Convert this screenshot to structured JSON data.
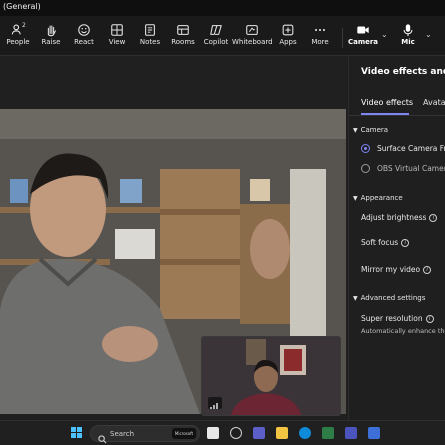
{
  "window": {
    "title": "(General)"
  },
  "toolbar": {
    "items": [
      {
        "label": "People",
        "count": "2",
        "icon": "people-icon"
      },
      {
        "label": "Raise",
        "icon": "hand-icon"
      },
      {
        "label": "React",
        "icon": "smile-icon"
      },
      {
        "label": "View",
        "icon": "view-grid-icon"
      },
      {
        "label": "Notes",
        "icon": "notes-icon"
      },
      {
        "label": "Rooms",
        "icon": "rooms-icon"
      },
      {
        "label": "Copilot",
        "icon": "copilot-icon"
      },
      {
        "label": "Whiteboard",
        "icon": "whiteboard-icon"
      },
      {
        "label": "Apps",
        "icon": "apps-add-icon"
      },
      {
        "label": "More",
        "icon": "more-icon"
      },
      {
        "label": "Camera",
        "icon": "camera-icon"
      },
      {
        "label": "Mic",
        "icon": "mic-icon"
      }
    ]
  },
  "panel": {
    "title": "Video effects and se",
    "tabs": [
      "Video effects",
      "Avata"
    ],
    "camera": {
      "heading": "Camera",
      "options": [
        {
          "label": "Surface Camera Fro",
          "selected": true
        },
        {
          "label": "OBS Virtual Camera",
          "selected": false
        }
      ]
    },
    "appearance": {
      "heading": "Appearance",
      "settings": [
        "Adjust brightness",
        "Soft focus",
        "Mirror my video"
      ]
    },
    "advanced": {
      "heading": "Advanced settings",
      "super_resolution": "Super resolution",
      "super_resolution_desc": "Automatically enhance the feeds"
    }
  },
  "taskbar": {
    "search_label": "Search",
    "search_badge": "Microsoft"
  },
  "colors": {
    "accent": "#7f85f5",
    "background": "#1f1f1f",
    "taskbar": "#202020"
  }
}
